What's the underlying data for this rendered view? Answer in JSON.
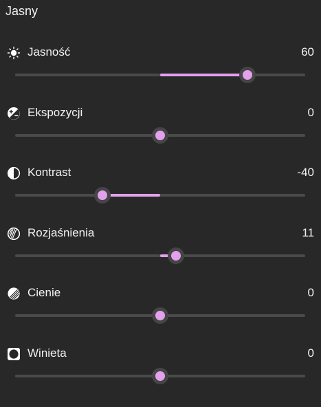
{
  "panel": {
    "title": "Jasny",
    "accent_color": "#e3a0ec",
    "track_color": "#4a4a4a",
    "background": "#282828"
  },
  "adjustments": [
    {
      "id": "brightness",
      "label": "Jasność",
      "value": "60",
      "min": -100,
      "max": 100,
      "icon": "sun-icon"
    },
    {
      "id": "exposure",
      "label": "Ekspozycji",
      "value": "0",
      "min": -100,
      "max": 100,
      "icon": "exposure-icon"
    },
    {
      "id": "contrast",
      "label": "Kontrast",
      "value": "-40",
      "min": -100,
      "max": 100,
      "icon": "contrast-icon"
    },
    {
      "id": "highlights",
      "label": "Rozjaśnienia",
      "value": "11",
      "min": -100,
      "max": 100,
      "icon": "highlights-icon"
    },
    {
      "id": "shadows",
      "label": "Cienie",
      "value": "0",
      "min": -100,
      "max": 100,
      "icon": "shadows-icon"
    },
    {
      "id": "vignette",
      "label": "Winieta",
      "value": "0",
      "min": -100,
      "max": 100,
      "icon": "vignette-icon"
    }
  ]
}
